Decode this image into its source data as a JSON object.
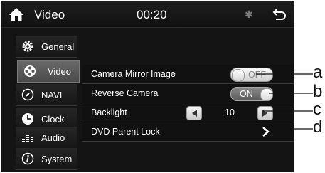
{
  "header": {
    "title": "Video",
    "clock": "00:20",
    "home_icon": "home-icon",
    "bluetooth_icon": "bluetooth-icon",
    "back_icon": "back-arrow-icon"
  },
  "sidebar": {
    "items": [
      {
        "label": "General",
        "icon": "gear-icon",
        "active": false
      },
      {
        "label": "Video",
        "icon": "video-reel-icon",
        "active": true
      },
      {
        "label": "NAVI",
        "icon": "compass-icon",
        "active": false
      },
      {
        "label": "Clock",
        "icon": "clock-icon",
        "active": false
      },
      {
        "label": "Audio",
        "icon": "equalizer-icon",
        "active": false
      },
      {
        "label": "System",
        "icon": "info-icon",
        "active": false
      }
    ]
  },
  "settings": {
    "camera_mirror": {
      "label": "Camera Mirror Image",
      "state": "OFF"
    },
    "reverse_camera": {
      "label": "Reverse Camera",
      "state": "ON"
    },
    "backlight": {
      "label": "Backlight",
      "value": "10"
    },
    "dvd_lock": {
      "label": "DVD Parent Lock"
    }
  },
  "callouts": {
    "a": "a",
    "b": "b",
    "c": "c",
    "d": "d"
  },
  "colors": {
    "screen_bg": "#141414",
    "active_item": "#5a5a5a",
    "text": "#ffffff"
  }
}
